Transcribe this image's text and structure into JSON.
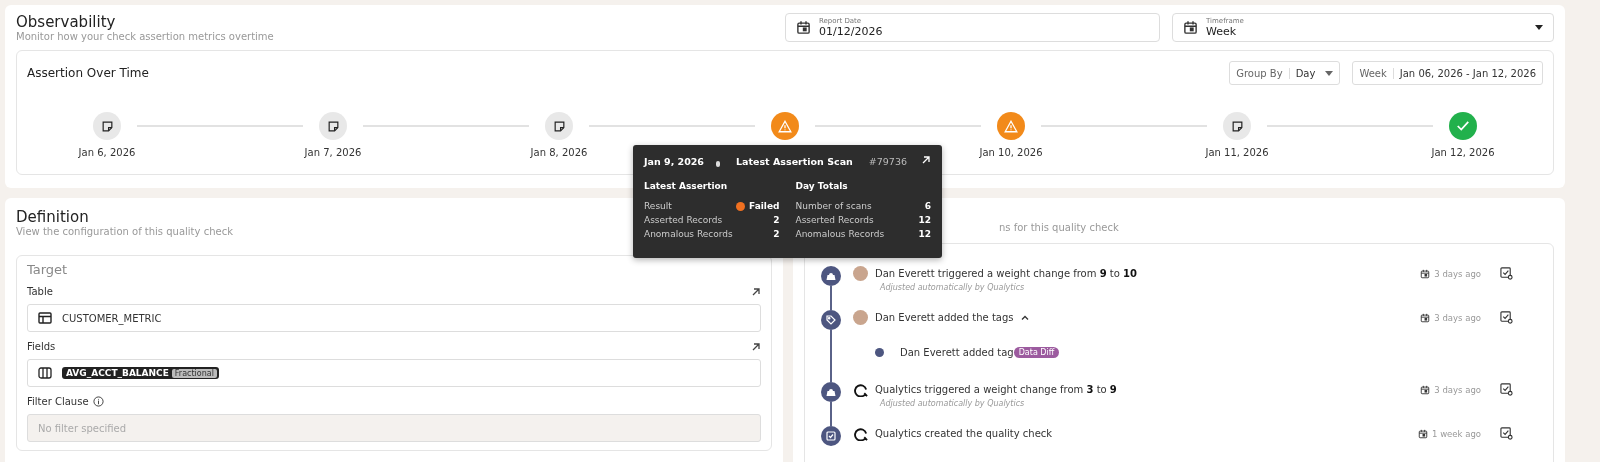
{
  "header": {
    "title": "Observability",
    "subtitle": "Monitor how your check assertion metrics overtime",
    "report_date": {
      "label": "Report Date",
      "value": "01/12/2026"
    },
    "timeframe": {
      "label": "Timeframe",
      "value": "Week"
    }
  },
  "assertion_over_time": {
    "title": "Assertion Over Time",
    "group_by": {
      "label": "Group By",
      "value": "Day"
    },
    "week": {
      "label": "Week",
      "value": "Jan 06, 2026 - Jan 12, 2026"
    },
    "days": [
      {
        "kind": "note",
        "label": "Jan 6, 2026"
      },
      {
        "kind": "note",
        "label": "Jan 7, 2026"
      },
      {
        "kind": "note",
        "label": "Jan 8, 2026"
      },
      {
        "kind": "warning"
      },
      {
        "kind": "warning",
        "label": "Jan 10, 2026"
      },
      {
        "kind": "note",
        "label": "Jan 11, 2026"
      },
      {
        "kind": "success",
        "label": "Jan 12, 2026"
      }
    ]
  },
  "tooltip": {
    "date": "Jan 9, 2026",
    "scan_label": "Latest Assertion Scan",
    "scan_id": "#79736",
    "latest": {
      "title": "Latest Assertion",
      "rows": [
        {
          "label": "Result",
          "value": "Failed",
          "color": "#f07020"
        },
        {
          "label": "Asserted Records",
          "value": "2"
        },
        {
          "label": "Anomalous Records",
          "value": "2"
        }
      ]
    },
    "totals": {
      "title": "Day Totals",
      "rows": [
        {
          "label": "Number of scans",
          "value": "6"
        },
        {
          "label": "Asserted Records",
          "value": "12"
        },
        {
          "label": "Anomalous Records",
          "value": "12"
        }
      ]
    }
  },
  "definition": {
    "title": "Definition",
    "subtitle": "View the configuration of this quality check",
    "section": "Target",
    "table": {
      "label": "Table",
      "value": "CUSTOMER_METRIC"
    },
    "fields": {
      "label": "Fields",
      "chips": [
        {
          "name": "AVG_ACCT_BALANCE",
          "type": "Fractional"
        }
      ]
    },
    "filter": {
      "label": "Filter Clause",
      "placeholder": "No filter specified"
    }
  },
  "activity": {
    "subtitle": "ns for this quality check",
    "items": [
      {
        "kind": "weight",
        "avatar": {
          "kind": "person"
        },
        "text": "Dan Everett triggered a weight change from **9** to **10**",
        "note": "Adjusted automatically by Qualytics",
        "time": "3 days ago"
      },
      {
        "kind": "tag",
        "avatar": {
          "kind": "person"
        },
        "text": "Dan Everett added the tags",
        "expanded": true,
        "time": "3 days ago",
        "children": [
          {
            "text": "Dan Everett added tag",
            "tag": "Data Diff"
          }
        ]
      },
      {
        "kind": "weight",
        "avatar": {
          "kind": "logo"
        },
        "text": "Qualytics triggered a weight change from **3** to **9**",
        "note": "Adjusted automatically by Qualytics",
        "time": "3 days ago"
      },
      {
        "kind": "check",
        "avatar": {
          "kind": "logo"
        },
        "text": "Qualytics created the quality check",
        "time": "1 week ago"
      }
    ]
  }
}
